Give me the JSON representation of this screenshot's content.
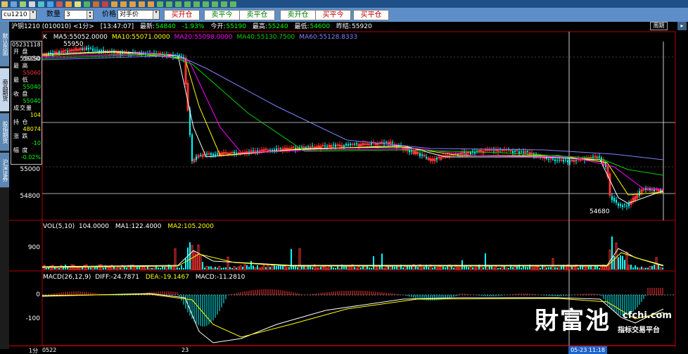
{
  "toolbar": {
    "icons": [
      {
        "name": "cut-icon",
        "color": "#e8c15a"
      },
      {
        "name": "copy-icon",
        "color": "#6fa0d8"
      },
      {
        "name": "paste-icon",
        "color": "#9bd06c"
      },
      {
        "name": "print-icon",
        "color": "#d7d7d7"
      },
      {
        "name": "refresh-icon",
        "color": "#56c1c9"
      },
      {
        "name": "play-icon",
        "color": "#4f9fe3"
      },
      {
        "name": "stop-icon",
        "color": "#c9584f"
      },
      {
        "name": "pen-icon",
        "color": "#f0a030"
      },
      {
        "name": "note-icon",
        "color": "#e3e373"
      },
      {
        "name": "chart-icon",
        "color": "#57b35a"
      },
      {
        "name": "bar-chart-icon",
        "color": "#d06b2a"
      },
      {
        "name": "candle-icon",
        "color": "#c84040"
      },
      {
        "name": "day-icon",
        "color": "#e0a040"
      },
      {
        "name": "week-icon",
        "color": "#e0a040"
      },
      {
        "name": "month-icon",
        "color": "#e0a040"
      },
      {
        "name": "quarter-icon",
        "color": "#e0a040"
      },
      {
        "name": "year-icon",
        "color": "#e0a040"
      },
      {
        "name": "min1-icon",
        "color": "#60b860"
      },
      {
        "name": "min3-icon",
        "color": "#60b860"
      },
      {
        "name": "min5-icon",
        "color": "#60b860"
      },
      {
        "name": "min15-icon",
        "color": "#60b860"
      },
      {
        "name": "min30-icon",
        "color": "#60b860"
      },
      {
        "name": "min60-icon",
        "color": "#60b860"
      },
      {
        "name": "min120-icon",
        "color": "#60b860"
      },
      {
        "name": "min240-icon",
        "color": "#60b860"
      },
      {
        "name": "custom-icon",
        "color": "#60b860"
      }
    ]
  },
  "order": {
    "contract": "cu1210",
    "qty_label": "数量",
    "qty_value": "3",
    "price_label": "价格",
    "price_value": "对手价",
    "buttons": [
      {
        "label": "买开仓",
        "color": "#c00000"
      },
      {
        "label": "卖平今",
        "color": "#008000"
      },
      {
        "label": "卖平仓",
        "color": "#008000"
      },
      {
        "label": "卖开仓",
        "color": "#008000"
      },
      {
        "label": "买平今",
        "color": "#c00000"
      },
      {
        "label": "买平仓",
        "color": "#c00000"
      }
    ]
  },
  "sidebar": {
    "tabs": [
      {
        "label": "默认页面",
        "active": false
      },
      {
        "label": "商品期货",
        "active": true
      },
      {
        "label": "股指期货",
        "active": false
      },
      {
        "label": "沪深证券",
        "active": false
      }
    ]
  },
  "header": {
    "title": "沪铜1210 (010010) <1分>",
    "time": "[13:47:07]",
    "latest_label": "最新:",
    "latest_value": "54840",
    "change_value": "-1.93%",
    "open_label": "今开:",
    "open_value": "55190",
    "high_label": "最高:",
    "high_value": "55240",
    "low_label": "最低:",
    "low_value": "54600",
    "prev_label": "昨结:",
    "prev_value": "55920",
    "period_button": "周期"
  },
  "ma_bar": {
    "prefix": "K",
    "items": [
      {
        "text": "MA5:55052.0000",
        "color": "#ffffff"
      },
      {
        "text": "MA10:55071.0000",
        "color": "#ffff00"
      },
      {
        "text": "MA20:55098.0000",
        "color": "#ff00ff"
      },
      {
        "text": "MA40:55130.7500",
        "color": "#00d000"
      },
      {
        "text": "MA60:55128.8333",
        "color": "#8080ff"
      }
    ]
  },
  "quote": {
    "date": "05231118",
    "rows": [
      {
        "label": "开 盘",
        "value": "55050",
        "color": "#ffffff"
      },
      {
        "label": "最 高",
        "value": "55060",
        "color": "#ff3333"
      },
      {
        "label": "最 低",
        "value": "55040",
        "color": "#00ff00"
      },
      {
        "label": "收 盘",
        "value": "55040",
        "color": "#00ff00"
      },
      {
        "label": "成交量",
        "value": "104",
        "color": "#ffff00"
      },
      {
        "label": "持 仓",
        "value": "48074",
        "color": "#ffff00"
      },
      {
        "label": "涨 跌",
        "value": "-10",
        "color": "#00ff00"
      },
      {
        "label": "幅 度",
        "value": "-0.02%",
        "color": "#00ff00"
      }
    ]
  },
  "price_panel": {
    "y_labels": [
      "55050",
      "55000",
      "54800"
    ],
    "high_mark": "55950",
    "low_mark": "54680"
  },
  "volume_panel": {
    "title_prefix": "VOL(5,10)",
    "vol_value": "104.0000",
    "ma1": "MA1:122.4000",
    "ma2": "MA2:105.2000",
    "y_label": "900"
  },
  "macd_panel": {
    "title": "MACD(26,12,9)",
    "diff": "DIFF:-24.7871",
    "dea": "DEA:-19.1467",
    "macd": "MACD:-11.2810",
    "y_labels": [
      "0",
      "-100"
    ]
  },
  "time_axis": {
    "labels": [
      "1分",
      "0522",
      "23"
    ],
    "cursor": "05-23 11:18"
  },
  "watermark": {
    "url": "cfchi.com",
    "tag": "指标交易平台"
  },
  "colors": {
    "up": "#ff3333",
    "down": "#00ffff",
    "border": "#b00000",
    "ma5": "#ffffff",
    "ma10": "#ffff00",
    "ma20": "#ff00ff",
    "ma40": "#00d000",
    "ma60": "#8080ff"
  }
}
